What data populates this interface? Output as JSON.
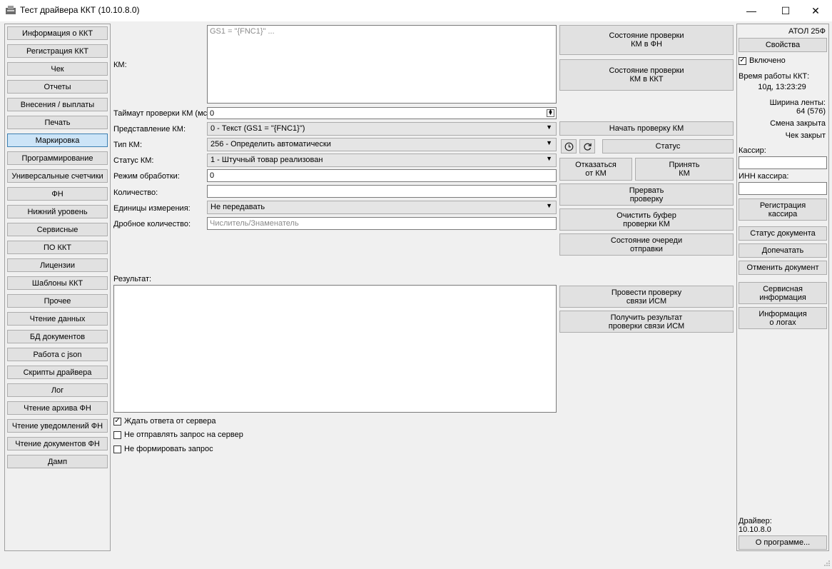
{
  "window": {
    "title": "Тест драйвера ККТ (10.10.8.0)",
    "minimize_glyph": "—",
    "maximize_glyph": "☐",
    "close_glyph": "✕"
  },
  "sidebar": {
    "items": [
      {
        "label": "Информация о ККТ"
      },
      {
        "label": "Регистрация ККТ"
      },
      {
        "label": "Чек"
      },
      {
        "label": "Отчеты"
      },
      {
        "label": "Внесения / выплаты"
      },
      {
        "label": "Печать"
      },
      {
        "label": "Маркировка",
        "selected": true
      },
      {
        "label": "Программирование"
      },
      {
        "label": "Универсальные счетчики"
      },
      {
        "label": "ФН"
      },
      {
        "label": "Нижний уровень"
      },
      {
        "label": "Сервисные"
      },
      {
        "label": "ПО ККТ"
      },
      {
        "label": "Лицензии"
      },
      {
        "label": "Шаблоны ККТ"
      },
      {
        "label": "Прочее"
      },
      {
        "label": "Чтение данных"
      },
      {
        "label": "БД документов"
      },
      {
        "label": "Работа с json"
      },
      {
        "label": "Скрипты драйвера"
      },
      {
        "label": "Лог"
      },
      {
        "label": "Чтение архива ФН"
      },
      {
        "label": "Чтение уведомлений ФН"
      },
      {
        "label": "Чтение документов ФН"
      },
      {
        "label": "Дамп"
      }
    ]
  },
  "form": {
    "km_label": "КМ:",
    "km_placeholder": "GS1 = \"{FNC1}\" ...",
    "timeout_label": "Таймаут проверки КМ (мс):",
    "timeout_value": "0",
    "km_repr_label": "Представление КМ:",
    "km_repr_value": "0 - Текст (GS1 = \"{FNC1}\")",
    "km_type_label": "Тип КМ:",
    "km_type_value": "256 - Определить автоматически",
    "km_status_label": "Статус КМ:",
    "km_status_value": "1 - Штучный товар реализован",
    "mode_label": "Режим обработки:",
    "mode_value": "0",
    "qty_label": "Количество:",
    "qty_value": "",
    "unit_label": "Единицы измерения:",
    "unit_value": "Не передавать",
    "fraction_label": "Дробное количество:",
    "fraction_placeholder": "Числитель/Знаменатель",
    "result_label": "Результат:",
    "checkboxes": [
      {
        "label": "Ждать ответа от сервера",
        "checked": true
      },
      {
        "label": "Не отправлять запрос на сервер",
        "checked": false
      },
      {
        "label": "Не формировать запрос",
        "checked": false
      }
    ]
  },
  "actions": {
    "check_state_fn": "Состояние проверки\nКМ в ФН",
    "check_state_kkt": "Состояние проверки\nКМ в ККТ",
    "start_check": "Начать проверку КМ",
    "status": "Статус",
    "decline": "Отказаться\nот КМ",
    "accept": "Принять\nКМ",
    "abort": "Прервать\nпроверку",
    "clear_buffer": "Очистить буфер\nпроверки КМ",
    "queue_state": "Состояние очереди\nотправки",
    "ism_check": "Провести проверку\nсвязи ИСМ",
    "ism_result": "Получить результат\nпроверки связи ИСМ"
  },
  "right": {
    "model": "АТОЛ 25Ф",
    "properties": "Свойства",
    "enabled_label": "Включено",
    "enabled": true,
    "uptime_label": "Время работы ККТ:",
    "uptime_value": "10д, 13:23:29",
    "tape_label": "Ширина ленты:",
    "tape_value": "64 (576)",
    "shift_status": "Смена закрыта",
    "receipt_status": "Чек закрыт",
    "cashier_label": "Кассир:",
    "cashier_value": "",
    "inn_label": "ИНН кассира:",
    "inn_value": "",
    "register_cashier": "Регистрация\nкассира",
    "doc_status": "Статус документа",
    "reprint": "Допечатать",
    "cancel_doc": "Отменить документ",
    "service_info": "Сервисная\nинформация",
    "log_info": "Информация\nо логах",
    "driver_label": "Драйвер:",
    "driver_version": "10.10.8.0",
    "about": "О программе..."
  }
}
